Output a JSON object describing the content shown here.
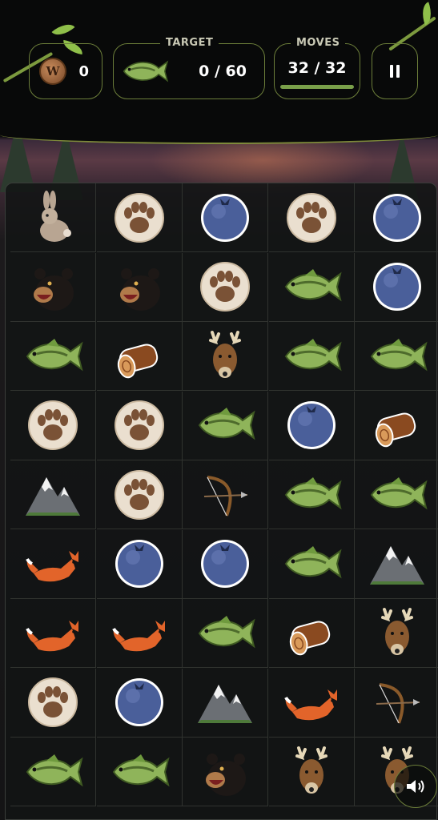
{
  "header": {
    "coins": "0",
    "target_label": "TARGET",
    "target_icon": "bass-fish-icon",
    "target_progress": "0 / 60",
    "moves_label": "MOVES",
    "moves_value": "32 / 32",
    "moves_remaining_fraction": 1.0,
    "coin_letter": "W"
  },
  "board": {
    "columns": 5,
    "rows": 9,
    "tiles": [
      [
        "rabbit",
        "paw",
        "blueberry",
        "paw",
        "blueberry"
      ],
      [
        "bear",
        "bear",
        "paw",
        "fish",
        "blueberry"
      ],
      [
        "fish",
        "log",
        "deer",
        "fish",
        "fish"
      ],
      [
        "paw",
        "paw",
        "fish",
        "blueberry",
        "log"
      ],
      [
        "mountain",
        "paw",
        "bow",
        "fish",
        "fish"
      ],
      [
        "fox",
        "blueberry",
        "blueberry",
        "fish",
        "mountain"
      ],
      [
        "fox",
        "fox",
        "fish",
        "log",
        "deer"
      ],
      [
        "paw",
        "blueberry",
        "mountain",
        "fox",
        "bow"
      ],
      [
        "fish",
        "fish",
        "bear",
        "deer",
        "deer"
      ]
    ]
  },
  "controls": {
    "pause_icon": "pause-icon",
    "sound_icon": "speaker-icon"
  },
  "colors": {
    "accent_green": "#7aa04a",
    "border_olive": "#6c7e3a"
  }
}
